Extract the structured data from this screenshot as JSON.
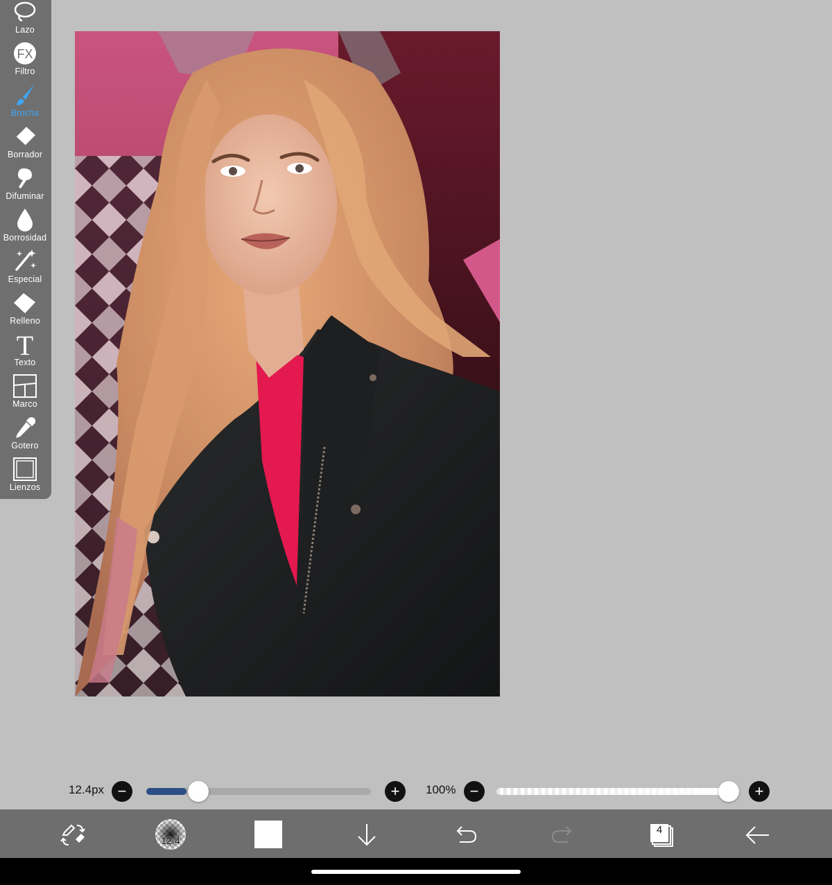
{
  "tools": [
    {
      "id": "lazo",
      "label": "Lazo",
      "icon": "lasso-icon",
      "active": false
    },
    {
      "id": "filtro",
      "label": "Filtro",
      "icon": "fx-filter-icon",
      "icon_text": "FX",
      "active": false
    },
    {
      "id": "brocha",
      "label": "Brocha",
      "icon": "brush-icon",
      "active": true
    },
    {
      "id": "borrador",
      "label": "Borrador",
      "icon": "eraser-icon",
      "active": false
    },
    {
      "id": "difuminar",
      "label": "Difuminar",
      "icon": "smudge-icon",
      "active": false
    },
    {
      "id": "borrosidad",
      "label": "Borrosidad",
      "icon": "blur-drop-icon",
      "active": false
    },
    {
      "id": "especial",
      "label": "Especial",
      "icon": "magic-wand-icon",
      "active": false
    },
    {
      "id": "relleno",
      "label": "Relleno",
      "icon": "fill-bucket-icon",
      "active": false
    },
    {
      "id": "texto",
      "label": "Texto",
      "icon": "text-icon",
      "icon_text": "T",
      "active": false
    },
    {
      "id": "marco",
      "label": "Marco",
      "icon": "frame-icon",
      "active": false
    },
    {
      "id": "gotero",
      "label": "Gotero",
      "icon": "eyedropper-icon",
      "active": false
    },
    {
      "id": "lienzos",
      "label": "Lienzos",
      "icon": "canvas-icon",
      "active": false
    }
  ],
  "brush_size": {
    "label": "12.4px",
    "value_fraction": 0.18
  },
  "opacity": {
    "label": "100%",
    "value_fraction": 1.0
  },
  "bottom_bar": {
    "brush_preview_text": "12.4",
    "layers_count": "4",
    "items": [
      "tool-swap-icon",
      "brush-preview",
      "color-swatch",
      "arrow-down-icon",
      "undo-icon",
      "redo-icon",
      "layers-icon",
      "back-arrow-icon"
    ]
  },
  "colors": {
    "accent": "#3da4f2",
    "primary_color": "#ffffff",
    "toolbar_bg": "#6f6f6f",
    "canvas_bg": "#c0c0c0",
    "slider_fill": "#2d4f86"
  }
}
